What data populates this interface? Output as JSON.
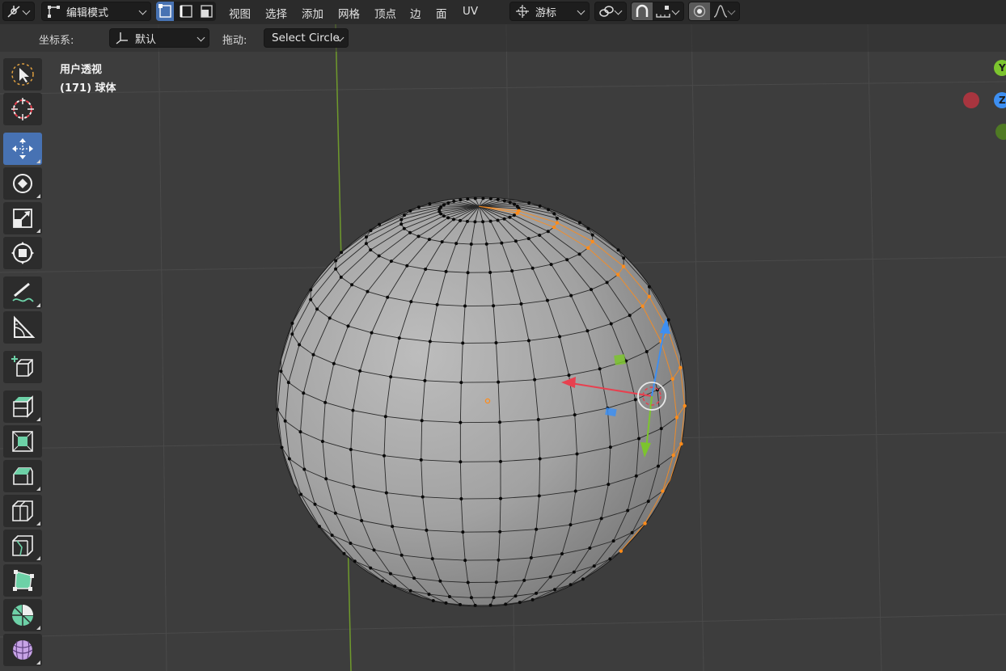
{
  "header": {
    "mode_label": "编辑模式",
    "menus": [
      "视图",
      "选择",
      "添加",
      "网格",
      "顶点",
      "边",
      "面",
      "UV"
    ],
    "pivot_label": "游标"
  },
  "tool_settings": {
    "orientation_label": "坐标系:",
    "orientation_value": "默认",
    "drag_label": "拖动:",
    "drag_value": "Select Circle"
  },
  "viewport": {
    "view_name": "用户透视",
    "object_info": "(171) 球体"
  },
  "gizmo": {
    "axis_y": "Y",
    "axis_z": "Z"
  },
  "toolbar": {
    "tools": [
      "select-box",
      "cursor",
      "move",
      "rotate",
      "scale",
      "transform",
      "annotate",
      "measure",
      "add-cube",
      "extrude-region",
      "inset-faces",
      "bevel",
      "loop-cut",
      "knife",
      "poly-build",
      "spin",
      "smooth"
    ],
    "active_tool": "move"
  },
  "colors": {
    "accent": "#4772b3",
    "selection": "#ff8c1a",
    "axis_x": "#e8404f",
    "axis_y": "#7cc42e",
    "axis_z": "#3d8ff2"
  }
}
